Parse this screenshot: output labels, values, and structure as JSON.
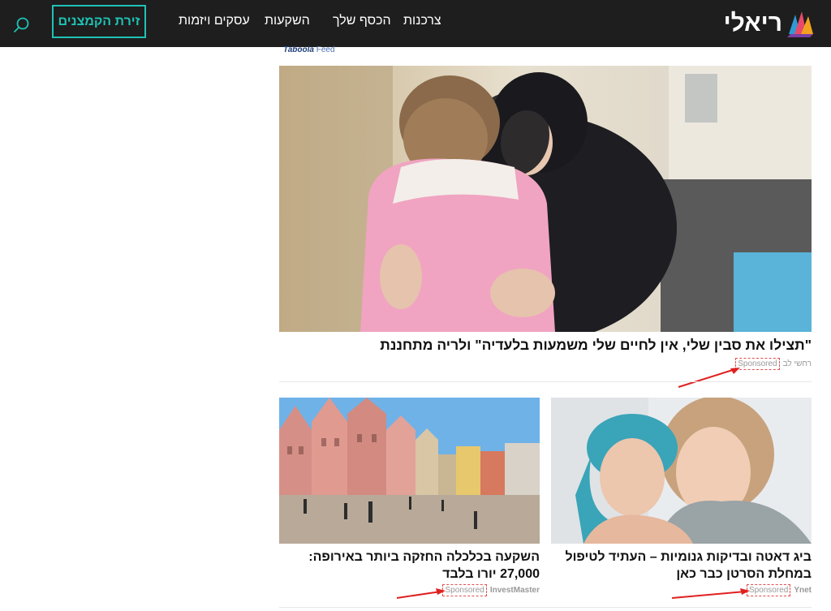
{
  "header": {
    "logo_text": "ריאלי",
    "nav": [
      "צרכנות",
      "הכסף שלך",
      "השקעות",
      "עסקים ויזמות"
    ],
    "cta_label": "זירת הקמצנים",
    "search_icon": "search-icon"
  },
  "feed": {
    "provider_label_bold": "Taboola",
    "provider_label_rest": "Feed"
  },
  "cards": [
    {
      "title": "\"תצילו את סבין שלי, אין לחיים שלי משמעות בלעדיה\" ולריה מתחננת",
      "source": "רחשי לב",
      "sponsored": "Sponsored"
    },
    {
      "title": "ביג דאטה ובדיקות גנומיות – העתיד לטיפול במחלת הסרטן כבר כאן",
      "source": "Ynet",
      "sponsored": "Sponsored"
    },
    {
      "title": "השקעה בכלכלה החזקה ביותר באירופה: 27,000 יורו בלבד",
      "source": "InvestMaster",
      "sponsored": "Sponsored"
    }
  ],
  "colors": {
    "header_bg": "#1e1e1e",
    "accent": "#1ec3b5",
    "annotation": "#e02020"
  }
}
